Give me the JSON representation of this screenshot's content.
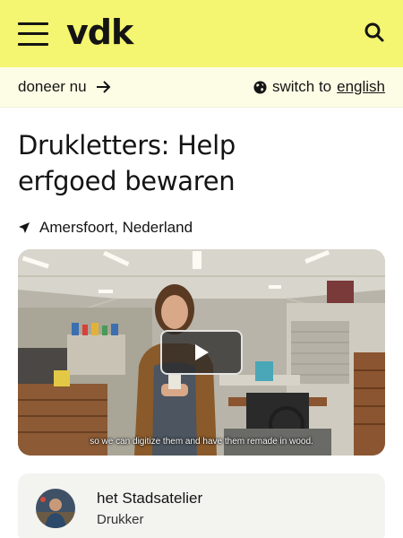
{
  "header": {
    "logo": "vdk",
    "menu_icon": "hamburger-menu-icon",
    "search_icon": "search-icon",
    "background": "#f4f570"
  },
  "subbar": {
    "donate_label": "doneer nu",
    "lang_prefix": "switch to",
    "lang_link": "english",
    "background": "#fdfde6"
  },
  "page": {
    "title_line1": "Drukletters: Help",
    "title_line2": "erfgoed bewaren",
    "location": "Amersfoort, Nederland"
  },
  "video": {
    "caption": "so we can digitize them and have them remade in wood."
  },
  "organizer": {
    "name": "het Stadsatelier",
    "role": "Drukker"
  }
}
